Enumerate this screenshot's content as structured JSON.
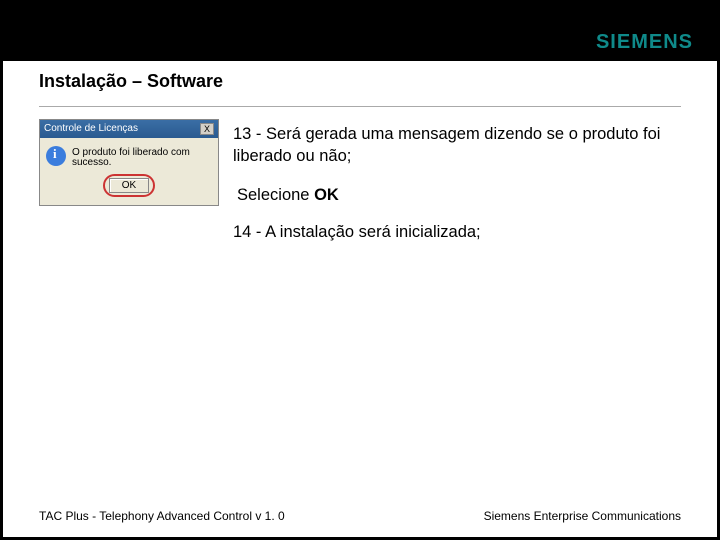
{
  "header": {
    "logo": "SIEMENS"
  },
  "title": "Instalação – Software",
  "dialog": {
    "title": "Controle de Licenças",
    "message": "O produto foi liberado com sucesso.",
    "ok_label": "OK",
    "close_label": "X"
  },
  "steps": {
    "s13": "13 - Será gerada uma mensagem dizendo se o produto foi liberado ou não;",
    "select_prefix": "Selecione ",
    "select_bold": "OK",
    "s14": "14 - A instalação será inicializada;"
  },
  "footer": {
    "left": "TAC Plus - Telephony Advanced Control v 1. 0",
    "right": "Siemens Enterprise Communications"
  }
}
